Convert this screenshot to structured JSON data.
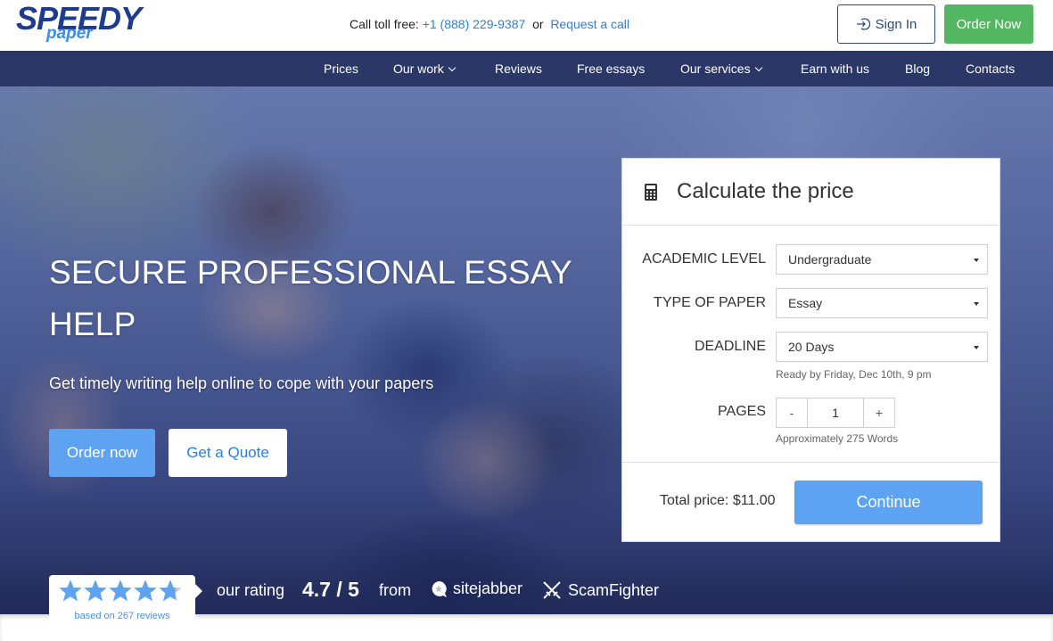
{
  "brand": {
    "logo_top": "SPEEDY",
    "logo_bottom": "paper"
  },
  "header": {
    "call_label": "Call toll free:",
    "phone": "+1 (888) 229-9387",
    "or_text": "or",
    "request_call": "Request a call",
    "sign_in": "Sign In",
    "order_now": "Order Now"
  },
  "nav": {
    "items": [
      {
        "label": "Prices",
        "has_dropdown": false
      },
      {
        "label": "Our work",
        "has_dropdown": true
      },
      {
        "label": "Reviews",
        "has_dropdown": false
      },
      {
        "label": "Free essays",
        "has_dropdown": false
      },
      {
        "label": "Our services",
        "has_dropdown": true
      },
      {
        "label": "Earn with us",
        "has_dropdown": false
      },
      {
        "label": "Blog",
        "has_dropdown": false
      },
      {
        "label": "Contacts",
        "has_dropdown": false
      }
    ]
  },
  "hero": {
    "title": "SECURE PROFESSIONAL ESSAY HELP",
    "subtitle": "Get timely writing help online to cope with your papers",
    "order_button": "Order now",
    "quote_button": "Get a Quote"
  },
  "rating": {
    "stars_value": 4.7,
    "stars_max": 5,
    "reviews_text": "based on 267 reviews",
    "label": "our rating",
    "value": "4.7 / 5",
    "from": "from",
    "sources": [
      "sitejabber",
      "ScamFighter"
    ],
    "star_color": "#5ea3f2"
  },
  "calculator": {
    "title": "Calculate the price",
    "academic_level": {
      "label": "ACADEMIC LEVEL",
      "value": "Undergraduate"
    },
    "paper_type": {
      "label": "TYPE OF PAPER",
      "value": "Essay"
    },
    "deadline": {
      "label": "DEADLINE",
      "value": "20 Days",
      "hint": "Ready by Friday, Dec 10th, 9 pm"
    },
    "pages": {
      "label": "PAGES",
      "minus": "-",
      "value": "1",
      "plus": "+",
      "hint": "Approximately 275 Words"
    },
    "total": "Total price: $11.00",
    "continue": "Continue"
  },
  "colors": {
    "nav_bg": "#2b3766",
    "accent_blue": "#5ea3f2",
    "link_blue": "#2b7fe0",
    "order_green": "#52b760",
    "logo_navy": "#1d3c8f"
  }
}
